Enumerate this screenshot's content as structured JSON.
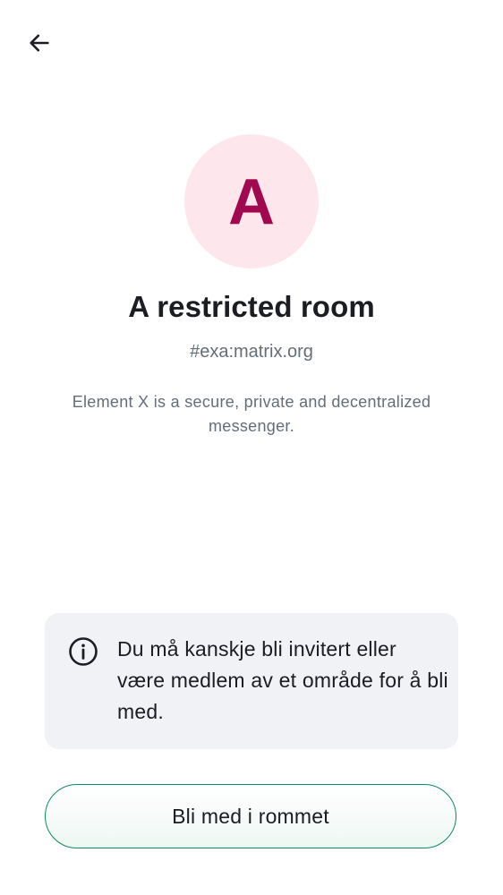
{
  "header": {
    "back_icon": "arrow-left-icon"
  },
  "room": {
    "avatar_letter": "A",
    "avatar_bg_color": "#fde7ec",
    "avatar_fg_color": "#a0094f",
    "title": "A restricted room",
    "alias": "#exa:matrix.org",
    "description": "Element X is a secure, private and decentralized messenger."
  },
  "notice": {
    "icon": "info-icon",
    "text": "Du må kanskje bli invitert eller være medlem av et område for å bli med."
  },
  "actions": {
    "join_label": "Bli med i rommet",
    "accent_color": "#0b8a5f"
  }
}
